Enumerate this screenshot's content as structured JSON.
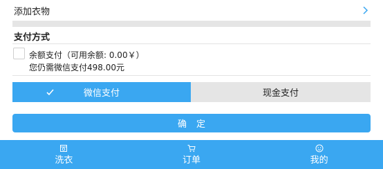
{
  "add_clothes": {
    "label": "添加衣物"
  },
  "payment": {
    "section_title": "支付方式",
    "balance_line": "余额支付（可用余额: 0.00￥）",
    "still_need_line": "您仍需微信支付498.00元",
    "methods": [
      {
        "label": "微信支付",
        "selected": true
      },
      {
        "label": "现金支付",
        "selected": false
      }
    ]
  },
  "confirm": {
    "label": "确定"
  },
  "bottom_nav": {
    "items": [
      {
        "label": "洗衣",
        "icon": "laundry-icon"
      },
      {
        "label": "订单",
        "icon": "cart-icon"
      },
      {
        "label": "我的",
        "icon": "profile-icon"
      }
    ]
  },
  "colors": {
    "accent": "#3aa7f1",
    "tab_inactive": "#e5e5e5",
    "gap_gray": "#e5e5e5"
  }
}
